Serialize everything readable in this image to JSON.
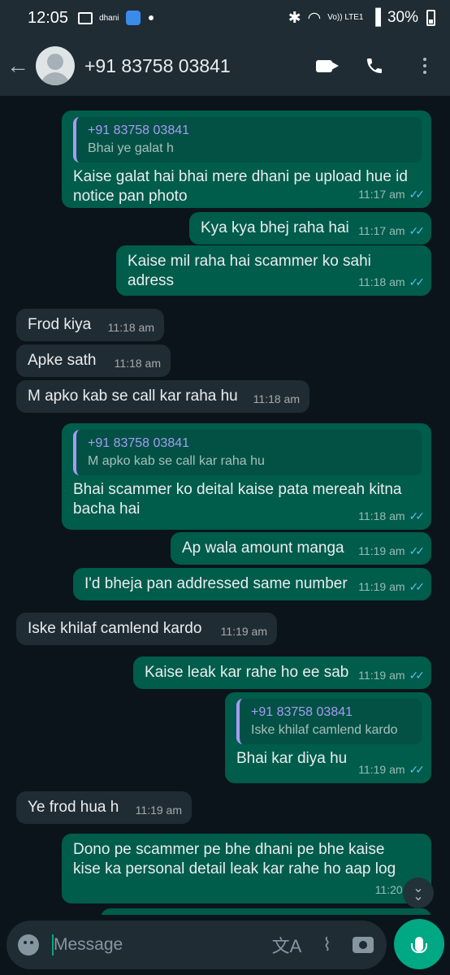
{
  "status_bar": {
    "time": "12:05",
    "notif_label": "dhani",
    "network": "Vo)) LTE1",
    "battery": "30%"
  },
  "header": {
    "contact": "+91 83758 03841"
  },
  "messages": [
    {
      "dir": "out",
      "quote_name": "+91 83758 03841",
      "quote_text": "Bhai ye galat h",
      "text": "Kaise galat hai bhai mere dhani pe upload hue id notice pan photo",
      "time": "11:17 am"
    },
    {
      "dir": "out",
      "text": "Kya kya bhej raha hai",
      "time": "11:17 am"
    },
    {
      "dir": "out",
      "text": "Kaise mil raha hai scammer ko sahi adress",
      "time": "11:18 am"
    },
    {
      "dir": "in",
      "text": "Frod kiya",
      "time": "11:18 am"
    },
    {
      "dir": "in",
      "text": "Apke sath",
      "time": "11:18 am"
    },
    {
      "dir": "in",
      "text": "M apko kab se call kar raha hu",
      "time": "11:18 am"
    },
    {
      "dir": "out",
      "quote_name": "+91 83758 03841",
      "quote_text": "M apko kab se call kar raha hu",
      "text": "Bhai scammer ko deital kaise pata mereah kitna bacha hai",
      "time": "11:18 am"
    },
    {
      "dir": "out",
      "text": "Ap wala amount manga",
      "time": "11:19 am"
    },
    {
      "dir": "out",
      "text": "I'd bheja pan addressed same number",
      "time": "11:19 am"
    },
    {
      "dir": "in",
      "text": "Iske khilaf camlend kardo",
      "time": "11:19 am"
    },
    {
      "dir": "out",
      "text": "Kaise leak kar rahe ho ee sab",
      "time": "11:19 am"
    },
    {
      "dir": "out",
      "quote_name": "+91 83758 03841",
      "quote_text": "Iske khilaf camlend kardo",
      "text": "Bhai kar diya hu",
      "time": "11:19 am"
    },
    {
      "dir": "in",
      "text": "Ye frod hua h",
      "time": "11:19 am"
    },
    {
      "dir": "out",
      "text": "Dono pe scammer pe bhe dhani pe bhe kaise kise ka personal detail leak kar rahe ho aap log",
      "time": "11:20 am"
    }
  ],
  "input": {
    "placeholder": "Message"
  },
  "icons": {
    "back": "arrow-left",
    "video": "video-camera",
    "call": "phone",
    "menu": "three-dots",
    "emoji": "smiley",
    "translate": "translate",
    "attach": "paperclip",
    "camera": "camera",
    "mic": "microphone"
  },
  "colors": {
    "outgoing": "#005c4b",
    "incoming": "#202c33",
    "accent": "#00a884",
    "read_ticks": "#53bdeb"
  }
}
